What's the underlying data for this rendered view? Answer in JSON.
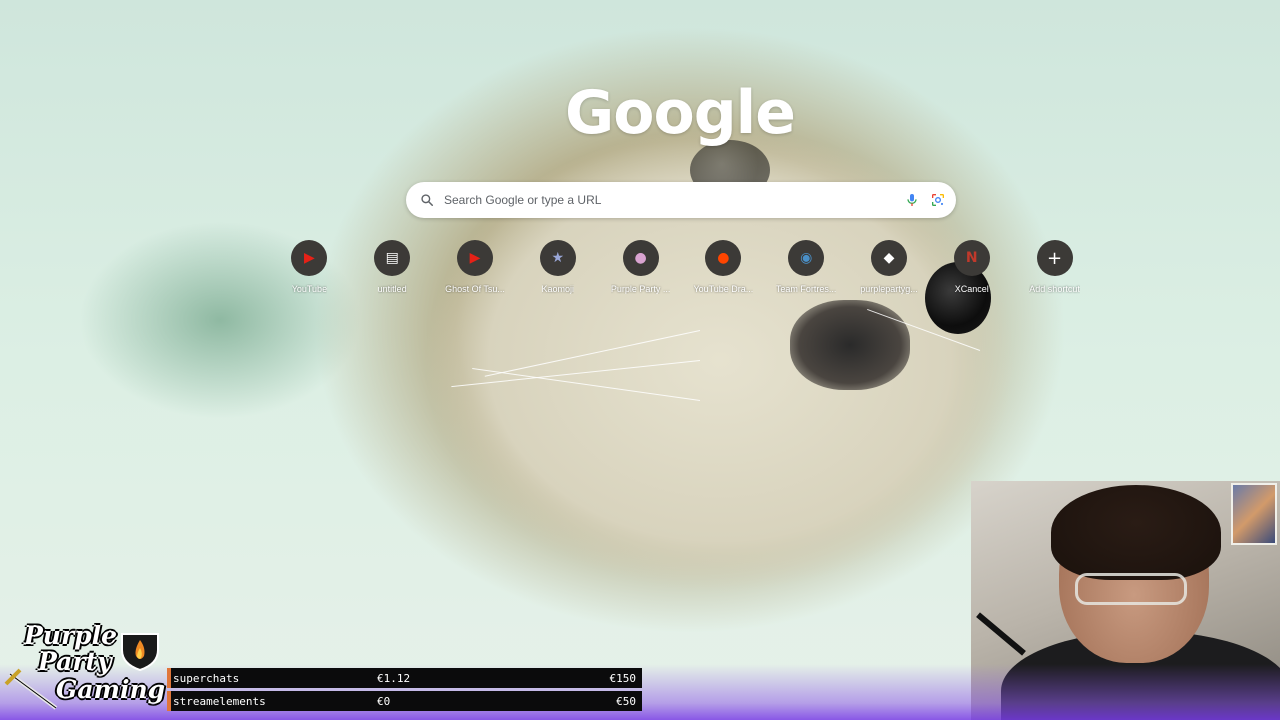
{
  "newtab": {
    "logo_text": "Google",
    "search": {
      "placeholder": "Search Google or type a URL"
    },
    "shortcuts": [
      {
        "label": "YouTube",
        "icon": "youtube-icon",
        "glyph": "▶",
        "color": "#e62117"
      },
      {
        "label": "untitled",
        "icon": "document-icon",
        "glyph": "▤",
        "color": "#ffffff"
      },
      {
        "label": "Ghost Of Tsu...",
        "icon": "youtube-icon",
        "glyph": "▶",
        "color": "#e62117"
      },
      {
        "label": "Kaomoji",
        "icon": "star-icon",
        "glyph": "★",
        "color": "#9aa7d8"
      },
      {
        "label": "Purple Party ...",
        "icon": "party-icon",
        "glyph": "●",
        "color": "#d9a3d0"
      },
      {
        "label": "YouTube Dra...",
        "icon": "reddit-icon",
        "glyph": "●",
        "color": "#ff4500"
      },
      {
        "label": "Team Fortres...",
        "icon": "steam-icon",
        "glyph": "◉",
        "color": "#4a90c8"
      },
      {
        "label": "purplepartyg...",
        "icon": "speech-bubble-icon",
        "glyph": "◆",
        "color": "#ffffff"
      },
      {
        "label": "XCancel",
        "icon": "x-cancel-icon",
        "glyph": "N",
        "color": "#c0392b"
      },
      {
        "label": "Add shortcut",
        "icon": "plus-icon",
        "glyph": "+",
        "color": "#ffffff"
      }
    ]
  },
  "stream_overlay": {
    "brand_lines": [
      "Purple",
      "Party",
      "Gaming"
    ],
    "stats": [
      {
        "name": "superchats",
        "current": "€1.12",
        "goal": "€150"
      },
      {
        "name": "streamelements",
        "current": "€0",
        "goal": "€50"
      }
    ],
    "accent_color": "#e0763a"
  }
}
